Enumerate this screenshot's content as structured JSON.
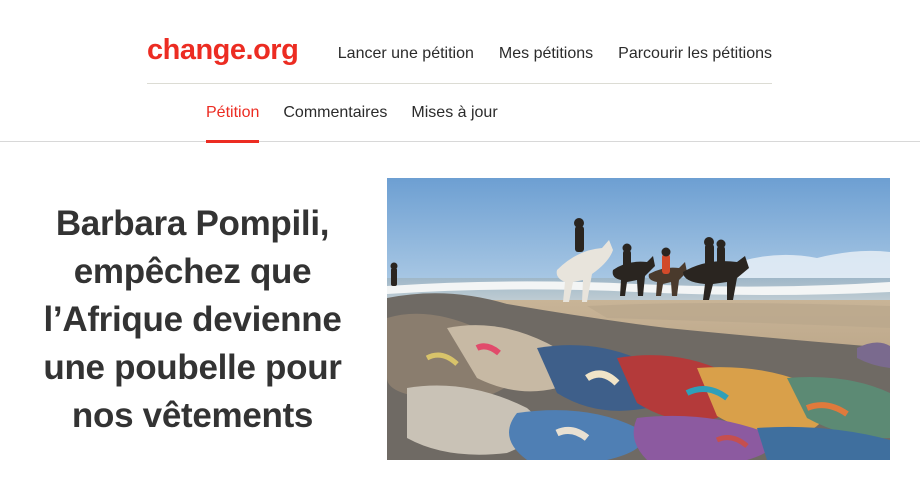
{
  "header": {
    "logo": "change.org",
    "nav": [
      {
        "label": "Lancer une pétition"
      },
      {
        "label": "Mes pétitions"
      },
      {
        "label": "Parcourir les pétitions"
      }
    ]
  },
  "tabs": [
    {
      "label": "Pétition",
      "active": true
    },
    {
      "label": "Commentaires",
      "active": false
    },
    {
      "label": "Mises à jour",
      "active": false
    }
  ],
  "petition": {
    "title": "Barbara Pompili, empêchez que l’Afrique devienne une poubelle pour nos vêtements"
  },
  "colors": {
    "brand_red": "#ec2c22",
    "text": "#2b2b2b"
  }
}
